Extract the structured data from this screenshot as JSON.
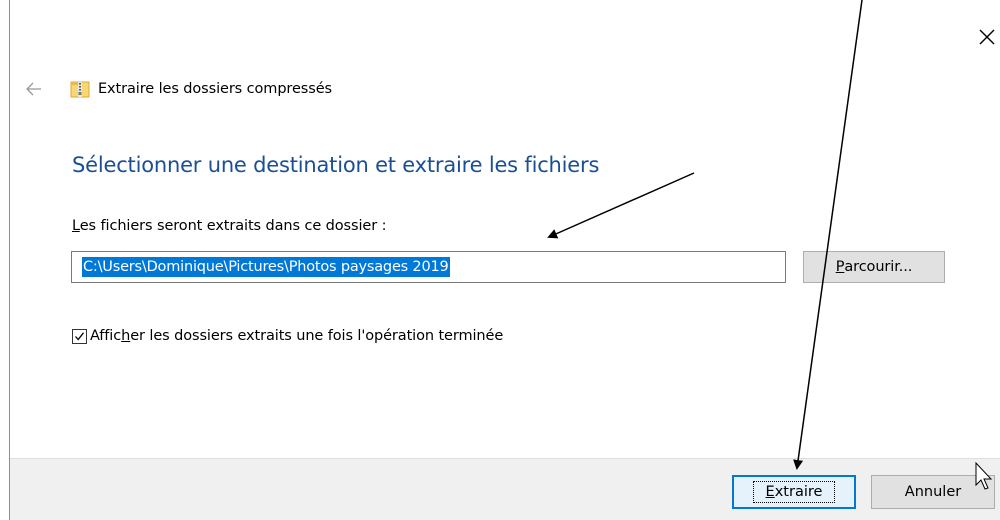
{
  "window": {
    "title": "Extraire les dossiers compressés",
    "back_icon": "back-arrow-icon",
    "zip_icon": "zip-folder-icon",
    "close_icon": "close-icon"
  },
  "main": {
    "heading": "Sélectionner une destination et extraire les fichiers",
    "folder_label_first": "L",
    "folder_label_rest": "es fichiers seront extraits dans ce dossier :",
    "path_value": "C:\\Users\\Dominique\\Pictures\\Photos paysages 2019",
    "browse_label_first": "P",
    "browse_label_rest": "arcourir...",
    "checkbox_checked": true,
    "checkbox_label_a": "Affic",
    "checkbox_label_b": "h",
    "checkbox_label_c": "er les dossiers extraits une fois l'opération terminée"
  },
  "footer": {
    "extract_first": "E",
    "extract_rest": "xtraire",
    "cancel_label": "Annuler"
  },
  "colors": {
    "heading": "#1a4f95",
    "selection": "#0078d7",
    "footer_bg": "#f0f0f0",
    "button_bg": "#e1e1e1"
  }
}
